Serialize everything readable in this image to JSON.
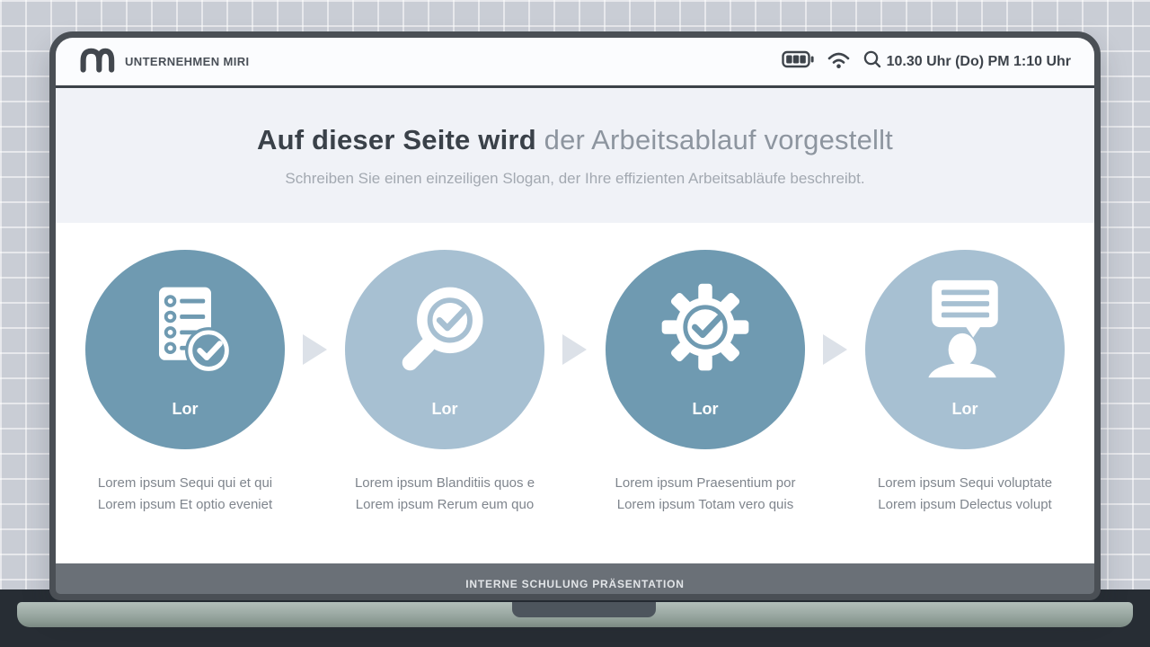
{
  "topbar": {
    "brand": "UNTERNEHMEN MIRI",
    "time": "10.30 Uhr (Do) PM 1:10 Uhr"
  },
  "header": {
    "title_bold": "Auf dieser Seite wird",
    "title_light": " der Arbeitsablauf vorgestellt",
    "subtitle": "Schreiben Sie einen einzeiligen Slogan, der Ihre effizienten Arbeitsabläufe beschreibt."
  },
  "steps": [
    {
      "label": "Lor",
      "icon": "checklist-check-icon",
      "variant": "dark",
      "caption_line1": "Lorem ipsum Sequi qui et qui",
      "caption_line2": "Lorem ipsum Et optio eveniet"
    },
    {
      "label": "Lor",
      "icon": "magnifier-check-icon",
      "variant": "light",
      "caption_line1": "Lorem ipsum Blanditiis quos e",
      "caption_line2": "Lorem ipsum Rerum eum quo"
    },
    {
      "label": "Lor",
      "icon": "gear-check-icon",
      "variant": "dark",
      "caption_line1": "Lorem ipsum Praesentium por",
      "caption_line2": "Lorem ipsum Totam vero quis"
    },
    {
      "label": "Lor",
      "icon": "person-chat-icon",
      "variant": "light",
      "caption_line1": "Lorem ipsum Sequi voluptate",
      "caption_line2": "Lorem ipsum Delectus volupt"
    }
  ],
  "footer": {
    "label": "INTERNE SCHULUNG PRÄSENTATION"
  },
  "colors": {
    "step_dark": "#6f9ab1",
    "step_light": "#a7c0d2",
    "frame": "#4a4f55",
    "footer_bar": "#6a7077",
    "title_dark": "#3a4149",
    "title_light": "#8d959f",
    "arrow": "#dce1e8"
  }
}
